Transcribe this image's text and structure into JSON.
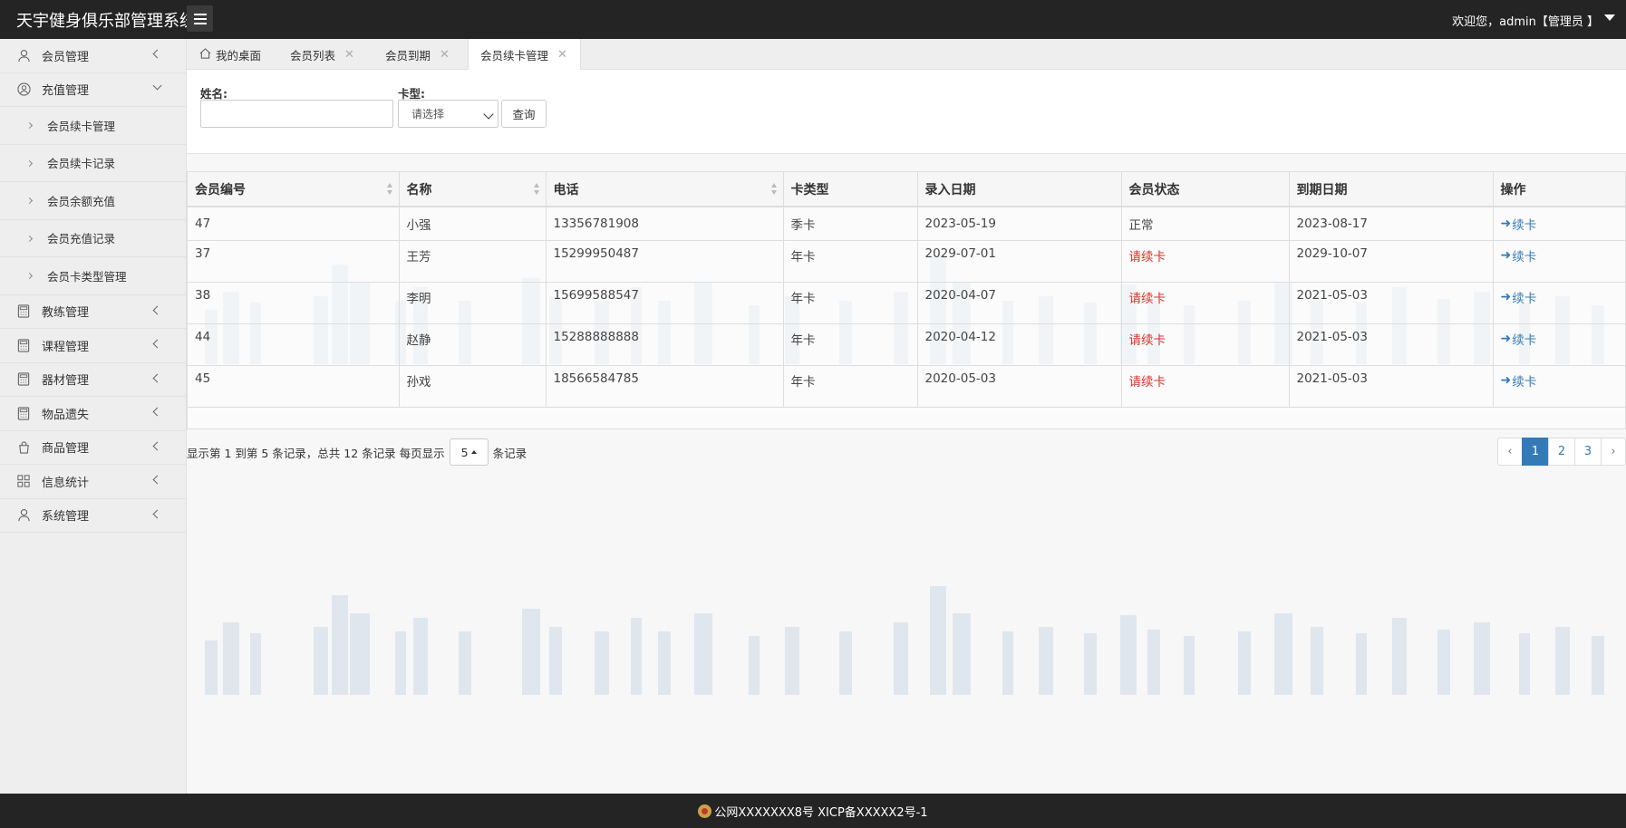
{
  "header": {
    "title": "天宇健身俱乐部管理系统",
    "welcome": "欢迎您，admin【管理员 】"
  },
  "sidebar": {
    "items": [
      {
        "label": "会员管理",
        "icon": "user-icon"
      },
      {
        "label": "充值管理",
        "icon": "user-circle-icon",
        "expanded": true,
        "children": [
          "会员续卡管理",
          "会员续卡记录",
          "会员余额充值",
          "会员充值记录",
          "会员卡类型管理"
        ]
      },
      {
        "label": "教练管理",
        "icon": "calculator-icon"
      },
      {
        "label": "课程管理",
        "icon": "calculator-icon"
      },
      {
        "label": "器材管理",
        "icon": "calculator-icon"
      },
      {
        "label": "物品遗失",
        "icon": "calculator-icon"
      },
      {
        "label": "商品管理",
        "icon": "bag-icon"
      },
      {
        "label": "信息统计",
        "icon": "grid-icon"
      },
      {
        "label": "系统管理",
        "icon": "user-icon"
      }
    ]
  },
  "tabs": [
    {
      "label": "我的桌面",
      "icon": "home-icon",
      "closable": false
    },
    {
      "label": "会员列表",
      "closable": true
    },
    {
      "label": "会员到期",
      "closable": true
    },
    {
      "label": "会员续卡管理",
      "closable": true,
      "active": true
    }
  ],
  "search": {
    "name_label": "姓名:",
    "name_value": "",
    "card_label": "卡型:",
    "card_selected": "请选择",
    "query_button": "查询"
  },
  "table": {
    "columns": [
      "会员编号",
      "名称",
      "电话",
      "卡类型",
      "录入日期",
      "会员状态",
      "到期日期",
      "操作"
    ],
    "rows": [
      {
        "id": "47",
        "name": "小强",
        "phone": "13356781908",
        "card": "季卡",
        "entry": "2023-05-19",
        "status": "正常",
        "status_color": "#444444",
        "expire": "2023-08-17",
        "action": "续卡"
      },
      {
        "id": "37",
        "name": "王芳",
        "phone": "15299950487",
        "card": "年卡",
        "entry": "2029-07-01",
        "status": "请续卡",
        "status_color": "#d9322a",
        "expire": "2029-10-07",
        "action": "续卡"
      },
      {
        "id": "38",
        "name": "李明",
        "phone": "15699588547",
        "card": "年卡",
        "entry": "2020-04-07",
        "status": "请续卡",
        "status_color": "#d9322a",
        "expire": "2021-05-03",
        "action": "续卡"
      },
      {
        "id": "44",
        "name": "赵静",
        "phone": "15288888888",
        "card": "年卡",
        "entry": "2020-04-12",
        "status": "请续卡",
        "status_color": "#d9322a",
        "expire": "2021-05-03",
        "action": "续卡"
      },
      {
        "id": "45",
        "name": "孙戏",
        "phone": "18566584785",
        "card": "年卡",
        "entry": "2020-05-03",
        "status": "请续卡",
        "status_color": "#d9322a",
        "expire": "2021-05-03",
        "action": "续卡"
      }
    ]
  },
  "pagination": {
    "info_prefix": "显示第 1 到第 5 条记录，总共 12 条记录 每页显示",
    "page_size": "5",
    "info_suffix": "条记录",
    "prev": "‹",
    "pages": [
      "1",
      "2",
      "3"
    ],
    "current": "1",
    "next": "›"
  },
  "footer": {
    "text": "公网XXXXXXX8号 XICP备XXXXX2号-1"
  },
  "colors": {
    "header_bg": "#242424",
    "accent": "#337ab7",
    "alert": "#d9322a"
  }
}
